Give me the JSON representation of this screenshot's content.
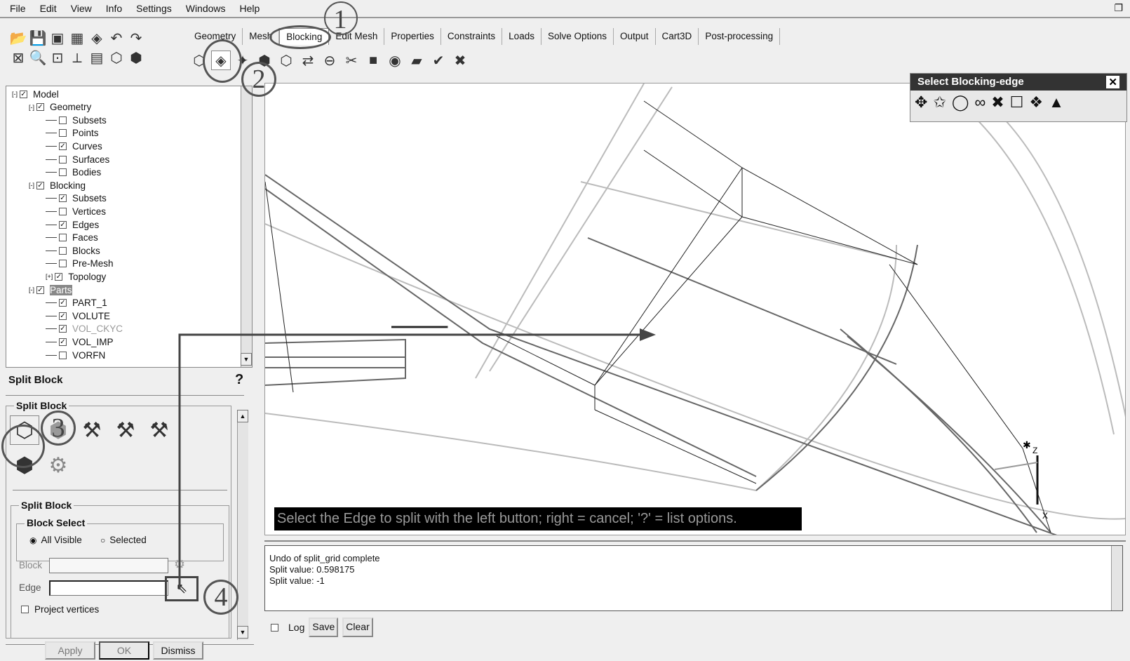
{
  "menu": [
    "File",
    "Edit",
    "View",
    "Info",
    "Settings",
    "Windows",
    "Help"
  ],
  "tabs": [
    "Geometry",
    "Mesh",
    "Blocking",
    "Edit Mesh",
    "Properties",
    "Constraints",
    "Loads",
    "Solve Options",
    "Output",
    "Cart3D",
    "Post-processing"
  ],
  "active_tab": "Blocking",
  "tree": [
    {
      "label": "Model",
      "level": 0,
      "checked": true,
      "exp": "-"
    },
    {
      "label": "Geometry",
      "level": 1,
      "checked": true,
      "exp": "-"
    },
    {
      "label": "Subsets",
      "level": 2,
      "checked": false
    },
    {
      "label": "Points",
      "level": 2,
      "checked": false
    },
    {
      "label": "Curves",
      "level": 2,
      "checked": true
    },
    {
      "label": "Surfaces",
      "level": 2,
      "checked": false
    },
    {
      "label": "Bodies",
      "level": 2,
      "checked": false
    },
    {
      "label": "Blocking",
      "level": 1,
      "checked": true,
      "exp": "-"
    },
    {
      "label": "Subsets",
      "level": 2,
      "checked": true
    },
    {
      "label": "Vertices",
      "level": 2,
      "checked": false
    },
    {
      "label": "Edges",
      "level": 2,
      "checked": true
    },
    {
      "label": "Faces",
      "level": 2,
      "checked": false
    },
    {
      "label": "Blocks",
      "level": 2,
      "checked": false
    },
    {
      "label": "Pre-Mesh",
      "level": 2,
      "checked": false
    },
    {
      "label": "Topology",
      "level": 2,
      "checked": true,
      "exp": "+"
    },
    {
      "label": "Parts",
      "level": 1,
      "checked": true,
      "exp": "-",
      "highlight": true
    },
    {
      "label": "PART_1",
      "level": 2,
      "checked": true
    },
    {
      "label": "VOLUTE",
      "level": 2,
      "checked": true
    },
    {
      "label": "VOL_CKYC",
      "level": 2,
      "checked": true,
      "dim": true
    },
    {
      "label": "VOL_IMP",
      "level": 2,
      "checked": true
    },
    {
      "label": "VORFN",
      "level": 2,
      "checked": false
    }
  ],
  "panel": {
    "title": "Split Block",
    "group1": "Split Block",
    "group2": "Split Block",
    "block_select": "Block Select",
    "radio_all": "All Visible",
    "radio_selected": "Selected",
    "radio_value": "All Visible",
    "block_label": "Block",
    "block_value": "",
    "edge_label": "Edge",
    "edge_value": "",
    "project_vertices": "Project vertices",
    "project_checked": false,
    "apply": "Apply",
    "ok": "OK",
    "dismiss": "Dismiss",
    "help": "?"
  },
  "select_toolbar": {
    "title": "Select Blocking-edge",
    "close": "✕"
  },
  "prompt": "Select the Edge to split with the left button; right = cancel; '?' = list options.",
  "log": {
    "lines": [
      "Undo of split_grid complete",
      "Split value: 0.598175",
      "Split value: -1"
    ],
    "log_label": "Log",
    "save": "Save",
    "clear": "Clear"
  },
  "annotations": [
    "1",
    "2",
    "3",
    "4"
  ],
  "axis_labels": {
    "z": "Z",
    "x": "X"
  }
}
